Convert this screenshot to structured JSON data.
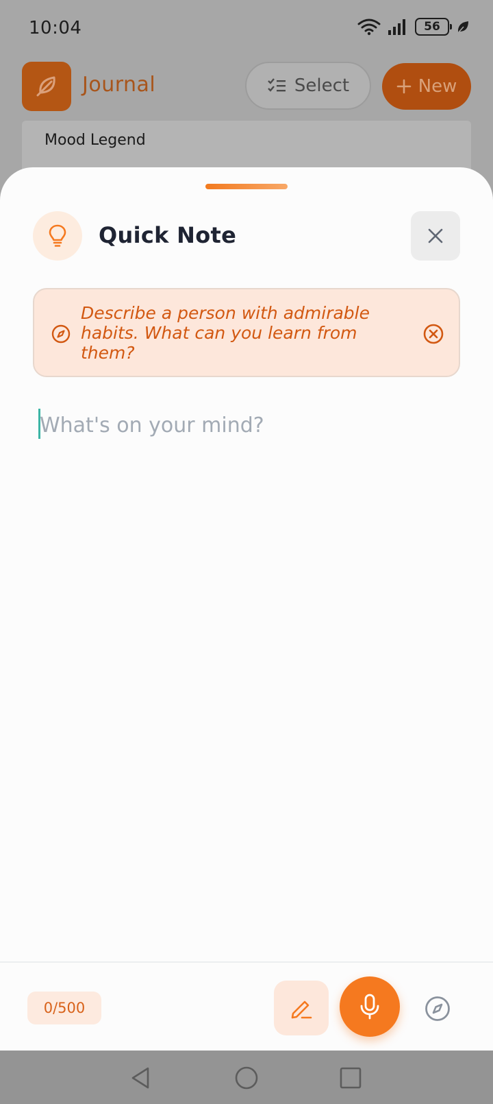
{
  "status_bar": {
    "time": "10:04",
    "battery": "56"
  },
  "app_header": {
    "title": "Journal",
    "select_label": "Select",
    "new_label": "New",
    "logo_icon": "feather-icon"
  },
  "mood_legend": {
    "title": "Mood Legend"
  },
  "quick_note": {
    "title": "Quick Note",
    "header_icon": "lightbulb-icon",
    "prompt": {
      "text": "Describe a person with admirable habits. What can you learn from them?",
      "icon": "compass-icon",
      "dismiss_icon": "close-circle-icon"
    },
    "input": {
      "value": "",
      "placeholder": "What's on your mind?"
    },
    "char_count": "0/500",
    "actions": {
      "handwrite_icon": "pen-icon",
      "mic_icon": "microphone-icon",
      "prompt_icon": "compass-icon"
    }
  },
  "colors": {
    "accent": "#f5791f",
    "accent_text": "#d25811",
    "prompt_bg": "#fde7db",
    "title_text": "#1f2433",
    "placeholder": "#a2aab4"
  },
  "nav_bar": {
    "back_icon": "triangle-back-icon",
    "home_icon": "circle-home-icon",
    "recents_icon": "square-recents-icon"
  }
}
